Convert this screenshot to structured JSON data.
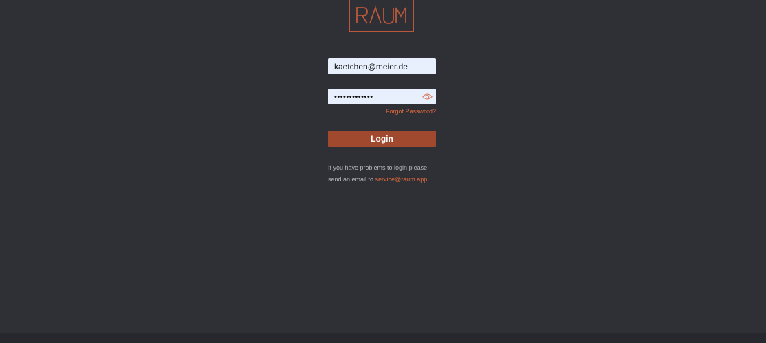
{
  "brand": {
    "logo_text": "RAUM",
    "accent_color": "#b9583a"
  },
  "login_form": {
    "email_value": "kaetchen@meier.de",
    "email_placeholder": "",
    "password_value": "•••••••••••••",
    "password_placeholder": "",
    "show_password_icon": "eye-icon",
    "forgot_password_label": "Forgot Password?",
    "login_label": "Login"
  },
  "help": {
    "line1": "If you have problems to login please",
    "line2_prefix": "send an email to ",
    "service_email": "service@raum.app"
  },
  "colors": {
    "background": "#2f3036",
    "footer": "#27282d",
    "button": "#a1492f",
    "link": "#e0693d",
    "input_bg": "#e8f0fe"
  }
}
